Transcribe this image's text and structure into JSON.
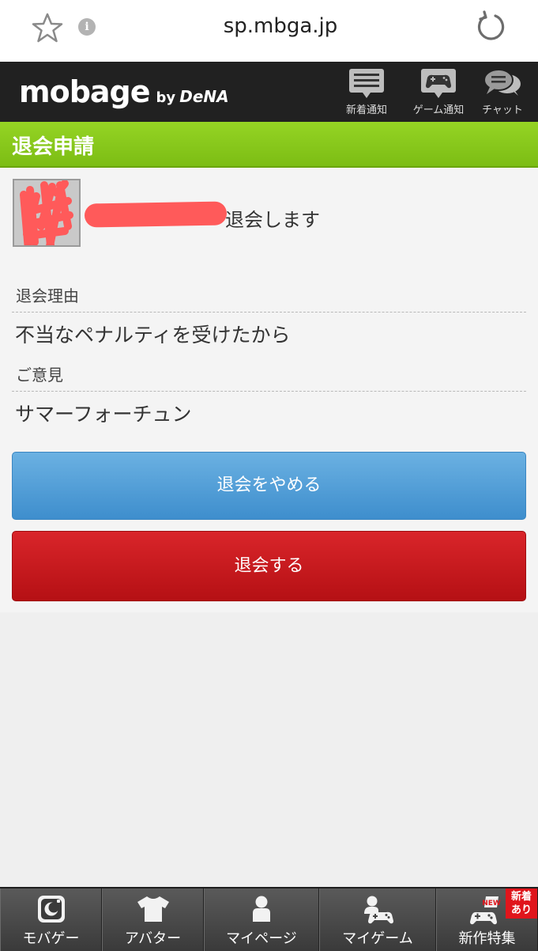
{
  "browser": {
    "url": "sp.mbga.jp",
    "star_icon": "star-outline-icon",
    "info_icon": "info-icon",
    "info_glyph": "i",
    "reload_icon": "reload-icon"
  },
  "header": {
    "logo_text": "mobage",
    "logo_by": "by",
    "logo_company": "DeNA",
    "buttons": [
      {
        "label": "新着通知",
        "icon": "notification-list-icon"
      },
      {
        "label": "ゲーム通知",
        "icon": "gamepad-bubble-icon"
      },
      {
        "label": "チャット",
        "icon": "chat-bubbles-icon"
      }
    ]
  },
  "page": {
    "title": "退会申請",
    "withdraw_message": "退会します",
    "reason_label": "退会理由",
    "reason_value": "不当なペナルティを受けたから",
    "opinion_label": "ご意見",
    "opinion_value": "サマーフォーチュン",
    "cancel_button": "退会をやめる",
    "confirm_button": "退会する"
  },
  "colors": {
    "title_bar": "#86c81b",
    "cancel_button": "#4a97d4",
    "confirm_button": "#c8191e",
    "header_bg": "#212121",
    "redaction": "#ff5a5a"
  },
  "footer": {
    "tabs": [
      {
        "label": "モバゲー",
        "icon": "mobage-app-icon"
      },
      {
        "label": "アバター",
        "icon": "tshirt-icon"
      },
      {
        "label": "マイページ",
        "icon": "person-icon"
      },
      {
        "label": "マイゲーム",
        "icon": "person-gamepad-icon"
      },
      {
        "label": "新作特集",
        "icon": "new-gamepad-icon",
        "badge_line1": "新着",
        "badge_line2": "あり",
        "new_tag": "NEW"
      }
    ]
  }
}
